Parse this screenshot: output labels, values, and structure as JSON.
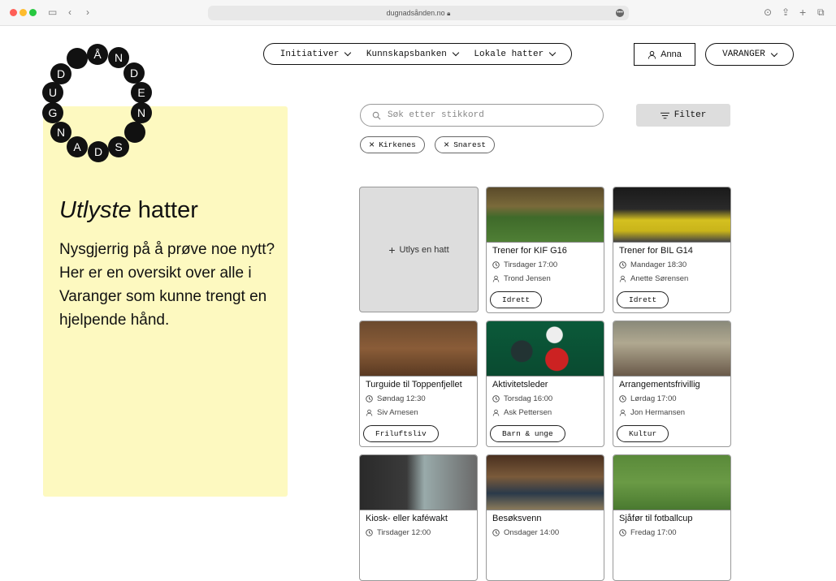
{
  "browser": {
    "url": "dugnadsånden.no",
    "lock_icon": "lock-icon"
  },
  "logo": {
    "letters": [
      "Å",
      "N",
      "D",
      "E",
      "N",
      "",
      "S",
      "D",
      "A",
      "N",
      "G",
      "U",
      "D",
      ""
    ]
  },
  "nav": {
    "items": [
      {
        "label": "Initiativer"
      },
      {
        "label": "Kunnskapsbanken"
      },
      {
        "label": "Lokale hatter"
      }
    ]
  },
  "user": {
    "name": "Anna"
  },
  "region": {
    "label": "VARANGER"
  },
  "panel": {
    "title_italic": "Utlyste",
    "title_rest": " hatter",
    "description": "Nysgjerrig på å prøve noe nytt? Her er en oversikt over alle i Varanger som kunne trengt en hjelpende hånd."
  },
  "search": {
    "placeholder": "Søk etter stikkord"
  },
  "filter": {
    "label": "Filter"
  },
  "chips": [
    {
      "label": "Kirkenes"
    },
    {
      "label": "Snarest"
    }
  ],
  "add_card": {
    "label": "Utlys en hatt"
  },
  "cards": [
    {
      "title": "Trener for KIF G16",
      "time": "Tirsdager 17:00",
      "person": "Trond Jensen",
      "tag": "Idrett"
    },
    {
      "title": "Trener for BIL G14",
      "time": "Mandager 18:30",
      "person": "Anette Sørensen",
      "tag": "Idrett"
    },
    {
      "title": "Turguide til Toppenfjellet",
      "time": "Søndag 12:30",
      "person": "Siv Arnesen",
      "tag": "Friluftsliv"
    },
    {
      "title": "Aktivitetsleder",
      "time": "Torsdag 16:00",
      "person": "Ask Pettersen",
      "tag": "Barn & unge"
    },
    {
      "title": "Arrangementsfrivillig",
      "time": "Lørdag 17:00",
      "person": "Jon Hermansen",
      "tag": "Kultur"
    },
    {
      "title": "Kiosk- eller kaféwakt",
      "time": "Tirsdager 12:00",
      "person": "",
      "tag": ""
    },
    {
      "title": "Besøksvenn",
      "time": "Onsdager 14:00",
      "person": "",
      "tag": ""
    },
    {
      "title": "Sjåfør til fotballcup",
      "time": "Fredag 17:00",
      "person": "",
      "tag": ""
    }
  ]
}
